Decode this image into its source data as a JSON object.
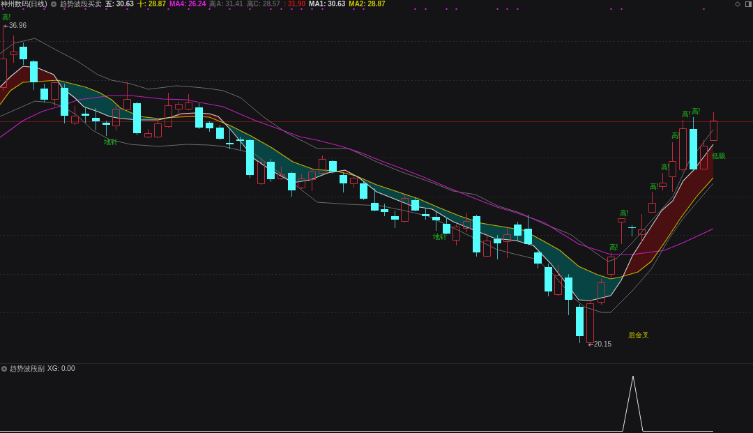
{
  "header": {
    "title": "神州数码(日线)",
    "indicator": "趋势波段买卖",
    "readings": [
      {
        "text": "五: 30.63",
        "color": "#d2d2d2"
      },
      {
        "text": "十: 28.87",
        "color": "#c8c800"
      },
      {
        "text": "MA4: 26.24",
        "color": "#e020e0"
      },
      {
        "text": "高A: 31.41",
        "color": "#5a5a5a"
      },
      {
        "text": "高C: 28.57",
        "color": "#5a5a5a"
      },
      {
        "text": ": 31.90",
        "color": "#c81414"
      },
      {
        "text": "MA1: 30.63",
        "color": "#d8d8d8"
      },
      {
        "text": "MA2: 28.87",
        "color": "#c8c800"
      }
    ]
  },
  "chart": {
    "high_label": "36.96",
    "low_label": "20.15",
    "signals": [
      {
        "text": "高!",
        "kind": "peak"
      },
      {
        "text": "地针",
        "kind": "bottom"
      },
      {
        "text": "地针",
        "kind": "bottom"
      },
      {
        "text": "高!",
        "kind": "peak"
      },
      {
        "text": "高!",
        "kind": "peak"
      },
      {
        "text": "后金叉",
        "kind": "cross"
      },
      {
        "text": "高!",
        "kind": "peak"
      },
      {
        "text": "高!",
        "kind": "peak"
      },
      {
        "text": "高!",
        "kind": "peak"
      },
      {
        "text": "高!",
        "kind": "peak"
      },
      {
        "text": "高!",
        "kind": "peak"
      },
      {
        "text": "低吸",
        "kind": "buy"
      }
    ]
  },
  "sub_panel": {
    "title": "趋势波段副",
    "reading": "XG: 0.00"
  }
}
